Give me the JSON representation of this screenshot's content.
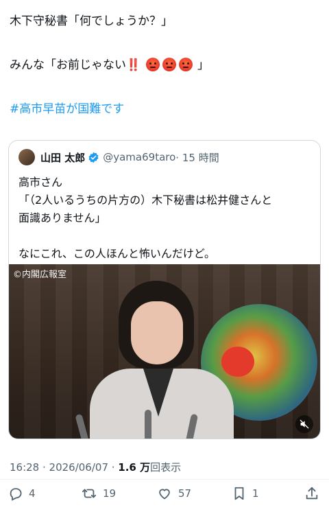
{
  "tweet": {
    "line1": "木下守秘書「何でしょうか？」",
    "line2_prefix": "みんな「お前じゃない",
    "line2_bang": "‼️",
    "line2_suffix": "」",
    "emoji": "pouting-face",
    "emoji_count": 3,
    "hashtag": "#高市早苗が国難です"
  },
  "quote": {
    "name": "山田 太郎",
    "handle": "@yama69taro",
    "time": "· 15 時間",
    "lines": [
      "高市さん",
      "「（2人いるうちの片方の）木下秘書は松井健さんと",
      "面識ありません」",
      "",
      "なにこれ、この人ほんと怖いんだけど。"
    ],
    "media_copyright": "©内閣広報室"
  },
  "meta": {
    "timestamp": "16:28 · 2026/06/07 · ",
    "views_count": "1.6 万",
    "views_label": "回表示"
  },
  "actions": {
    "reply_count": "4",
    "retweet_count": "19",
    "like_count": "57",
    "bookmark_count": "1"
  },
  "colors": {
    "accent": "#1d9bf0",
    "text": "#0f1419",
    "muted": "#536471",
    "border": "#cfd9de"
  }
}
